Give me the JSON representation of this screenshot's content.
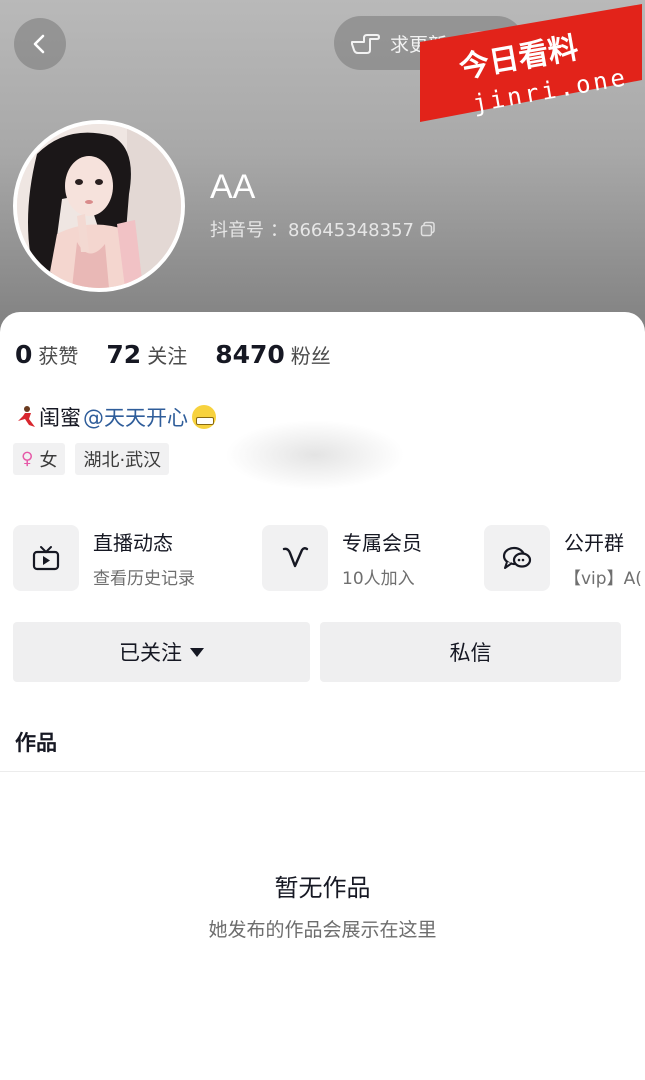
{
  "header": {
    "update_button_label": "求更新",
    "nickname": "AA",
    "douyin_id_label": "抖音号",
    "douyin_id_value": "：86645348357"
  },
  "watermark": {
    "line1": "今日看料",
    "line2": "jinri.one",
    "color": "#e2231a"
  },
  "stats": [
    {
      "value": "0",
      "label": "获赞"
    },
    {
      "value": "72",
      "label": "关注"
    },
    {
      "value": "8470",
      "label": "粉丝"
    }
  ],
  "bio": {
    "prefix_icon": "dancer-emoji",
    "text": "闺蜜",
    "mention": "@天天开心",
    "suffix_icon": "grin-emoji"
  },
  "tags": [
    {
      "icon": "female-icon",
      "label": "女"
    },
    {
      "label": "湖北·武汉"
    }
  ],
  "features": [
    {
      "icon": "tv-icon",
      "title": "直播动态",
      "subtitle": "查看历史记录"
    },
    {
      "icon": "vip-v-icon",
      "title": "专属会员",
      "subtitle": "10人加入"
    },
    {
      "icon": "chat-bubbles-icon",
      "title": "公开群",
      "subtitle": "【vip】A("
    }
  ],
  "actions": {
    "follow_label": "已关注",
    "message_label": "私信"
  },
  "works": {
    "tab_label": "作品",
    "empty_title": "暂无作品",
    "empty_subtitle": "她发布的作品会展示在这里"
  }
}
